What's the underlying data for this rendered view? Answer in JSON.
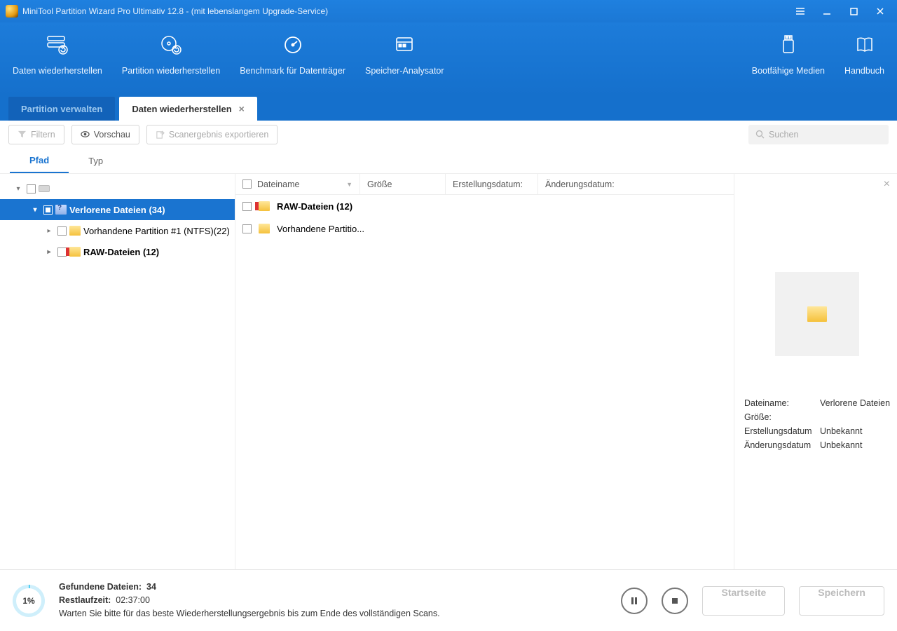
{
  "titlebar": {
    "title": "MiniTool Partition Wizard Pro Ultimativ 12.8 - (mit lebenslangem Upgrade-Service)"
  },
  "ribbon": {
    "items": [
      {
        "label": "Daten wiederherstellen"
      },
      {
        "label": "Partition wiederherstellen"
      },
      {
        "label": "Benchmark für Datenträger"
      },
      {
        "label": "Speicher-Analysator"
      }
    ],
    "right": [
      {
        "label": "Bootfähige Medien"
      },
      {
        "label": "Handbuch"
      }
    ]
  },
  "tabs": [
    {
      "label": "Partition verwalten",
      "active": false
    },
    {
      "label": "Daten wiederherstellen",
      "active": true
    }
  ],
  "toolbar": {
    "filter": "Filtern",
    "preview": "Vorschau",
    "export": "Scanergebnis exportieren",
    "search_placeholder": "Suchen"
  },
  "subtabs": [
    {
      "label": "Pfad",
      "active": true
    },
    {
      "label": "Typ",
      "active": false
    }
  ],
  "tree": {
    "root_label": "",
    "lost": "Verlorene Dateien (34)",
    "existing": "Vorhandene Partition #1 (NTFS)(22)",
    "raw": "RAW-Dateien (12)"
  },
  "list": {
    "headers": {
      "name": "Dateiname",
      "size": "Größe",
      "created": "Erstellungsdatum:",
      "modified": "Änderungsdatum:"
    },
    "rows": [
      {
        "name": "RAW-Dateien (12)",
        "bold": true,
        "icon": "raw"
      },
      {
        "name": "Vorhandene Partitio...",
        "bold": false,
        "icon": "folder"
      }
    ]
  },
  "preview": {
    "name_label": "Dateiname:",
    "name_value": "Verlorene Dateien",
    "size_label": "Größe:",
    "size_value": "",
    "created_label": "Erstellungsdatum",
    "created_value": "Unbekannt",
    "modified_label": "Änderungsdatum",
    "modified_value": "Unbekannt"
  },
  "footer": {
    "percent": "1%",
    "found_label": "Gefundene Dateien:",
    "found_value": "34",
    "remaining_label": "Restlaufzeit:",
    "remaining_value": "02:37:00",
    "hint": "Warten Sie bitte für das beste Wiederherstellungsergebnis bis zum Ende des vollständigen Scans.",
    "home": "Startseite",
    "save": "Speichern"
  }
}
